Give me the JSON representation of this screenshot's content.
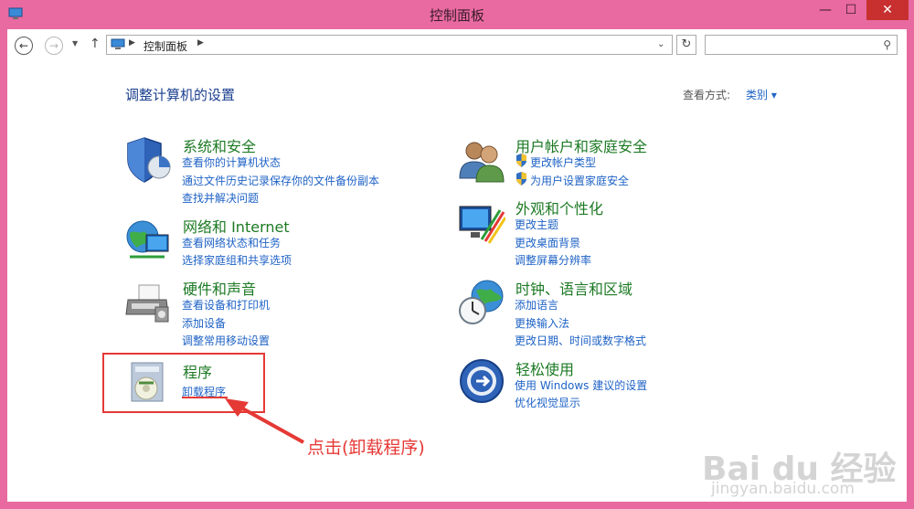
{
  "window": {
    "title": "控制面板"
  },
  "nav": {
    "address_label": "控制面板",
    "search_placeholder": ""
  },
  "main": {
    "heading": "调整计算机的设置",
    "view_label": "查看方式:",
    "view_value": "类别 ▾"
  },
  "categories": [
    {
      "title": "系统和安全",
      "icon": "shield-icon",
      "links": [
        "查看你的计算机状态",
        "通过文件历史记录保存你的文件备份副本",
        "查找并解决问题"
      ]
    },
    {
      "title": "网络和 Internet",
      "icon": "network-globe-icon",
      "links": [
        "查看网络状态和任务",
        "选择家庭组和共享选项"
      ]
    },
    {
      "title": "硬件和声音",
      "icon": "printer-icon",
      "links": [
        "查看设备和打印机",
        "添加设备",
        "调整常用移动设置"
      ]
    },
    {
      "title": "程序",
      "icon": "programs-icon",
      "links": [
        "卸载程序"
      ]
    },
    {
      "title": "用户帐户和家庭安全",
      "icon": "users-icon",
      "links": [
        "更改帐户类型",
        "为用户设置家庭安全"
      ]
    },
    {
      "title": "外观和个性化",
      "icon": "monitor-palette-icon",
      "links": [
        "更改主题",
        "更改桌面背景",
        "调整屏幕分辨率"
      ]
    },
    {
      "title": "时钟、语言和区域",
      "icon": "clock-globe-icon",
      "links": [
        "添加语言",
        "更换输入法",
        "更改日期、时间或数字格式"
      ]
    },
    {
      "title": "轻松使用",
      "icon": "ease-of-access-icon",
      "links": [
        "使用 Windows 建议的设置",
        "优化视觉显示"
      ]
    }
  ],
  "annotation": {
    "text": "点击(卸载程序)"
  },
  "watermark": {
    "brand": "Bai du 经验",
    "url": "jingyan.baidu.com"
  },
  "colors": {
    "frame": "#e86aa0",
    "close": "#c7302f",
    "link": "#1e62c6",
    "category": "#1d7a24",
    "annotation": "#e53935"
  }
}
